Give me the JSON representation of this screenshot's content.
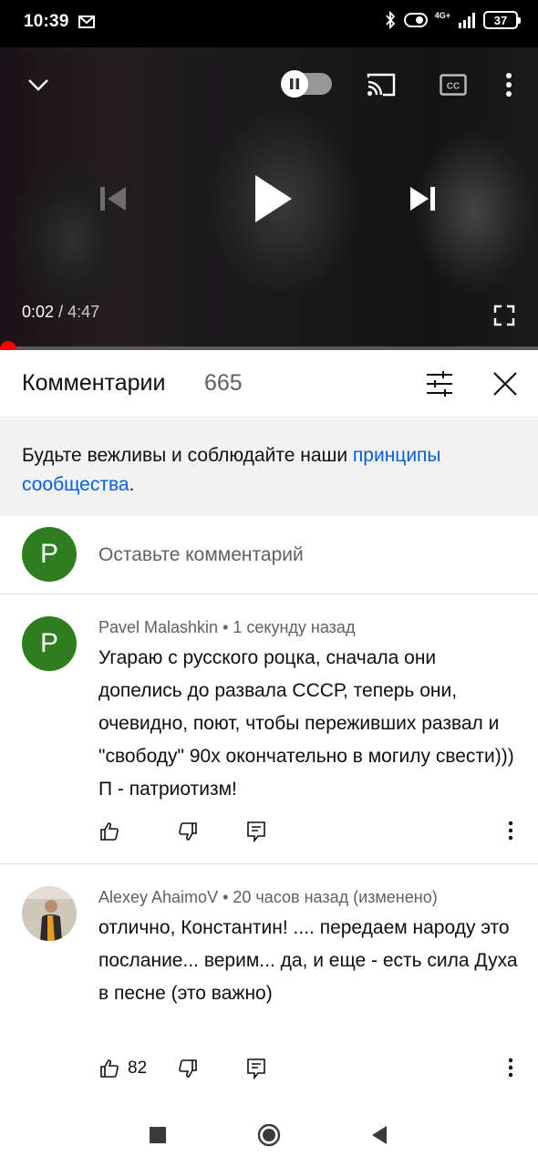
{
  "status_bar": {
    "time": "10:39",
    "network": "4G+",
    "battery": "37"
  },
  "player": {
    "current_time": "0:02",
    "separator": "/",
    "duration": "4:47",
    "progress_fraction": 0.007,
    "progress_color": "#ff0000"
  },
  "comments": {
    "title": "Комментарии",
    "count": "665"
  },
  "guidelines": {
    "text_prefix": "Будьте вежливы и соблюдайте наши ",
    "link_text": "принципы сообщества",
    "text_suffix": "."
  },
  "compose": {
    "avatar_letter": "P",
    "placeholder": "Оставьте комментарий"
  },
  "comment_list": [
    {
      "avatar_letter": "P",
      "author": "Pavel Malashkin",
      "time": "1 секунду назад",
      "text": "Угараю с русского роцка, сначала они допелись до развала СССР, теперь они, очевидно, поют, чтобы переживших развал и \"свободу\" 90х  окончательно в могилу свести))) П - патриотизм!",
      "likes": ""
    },
    {
      "author": "Alexey AhaimoV",
      "time": "20 часов назад (изменено)",
      "text": "отлично, Константин! .... передаем народу это послание... верим... да, и еще - есть сила Духа в песне (это важно)",
      "likes": "82"
    }
  ],
  "colors": {
    "avatar_green": "#2e7d1f",
    "link_blue": "#065fd4",
    "progress_red": "#ff0000"
  }
}
